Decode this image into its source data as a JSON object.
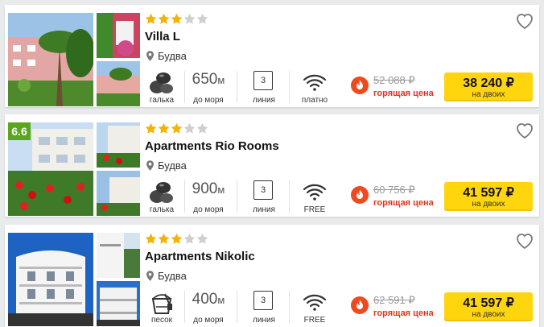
{
  "colors": {
    "star_filled": "#f5b301",
    "star_empty": "#cfcfcf",
    "price_button": "#ffd50d",
    "hot_text": "#e0361d",
    "rating_badge": "#5aa61c"
  },
  "listings": [
    {
      "stars": 3,
      "max_stars": 5,
      "name": "Villa L",
      "location": "Будва",
      "rating": null,
      "beach_icon": "pebbles-icon",
      "beach_label": "галька",
      "distance": "650",
      "distance_unit": "м",
      "distance_label": "до моря",
      "line": "3",
      "line_label": "линия",
      "wifi_label": "платно",
      "old_price": "52 088 ₽",
      "hot_label": "горящая цена",
      "price": "38 240 ₽",
      "price_note": "на двоих"
    },
    {
      "stars": 3,
      "max_stars": 5,
      "name": "Apartments Rio Rooms",
      "location": "Будва",
      "rating": "6.6",
      "beach_icon": "pebbles-icon",
      "beach_label": "галька",
      "distance": "900",
      "distance_unit": "м",
      "distance_label": "до моря",
      "line": "3",
      "line_label": "линия",
      "wifi_label": "FREE",
      "old_price": "60 756 ₽",
      "hot_label": "горящая цена",
      "price": "41 597 ₽",
      "price_note": "на двоих"
    },
    {
      "stars": 3,
      "max_stars": 5,
      "name": "Apartments Nikolic",
      "location": "Будва",
      "rating": null,
      "beach_icon": "sand-bucket-icon",
      "beach_label": "песок",
      "distance": "400",
      "distance_unit": "м",
      "distance_label": "до моря",
      "line": "3",
      "line_label": "линия",
      "wifi_label": "FREE",
      "old_price": "62 591 ₽",
      "hot_label": "горящая цена",
      "price": "41 597 ₽",
      "price_note": "на двоих"
    }
  ]
}
